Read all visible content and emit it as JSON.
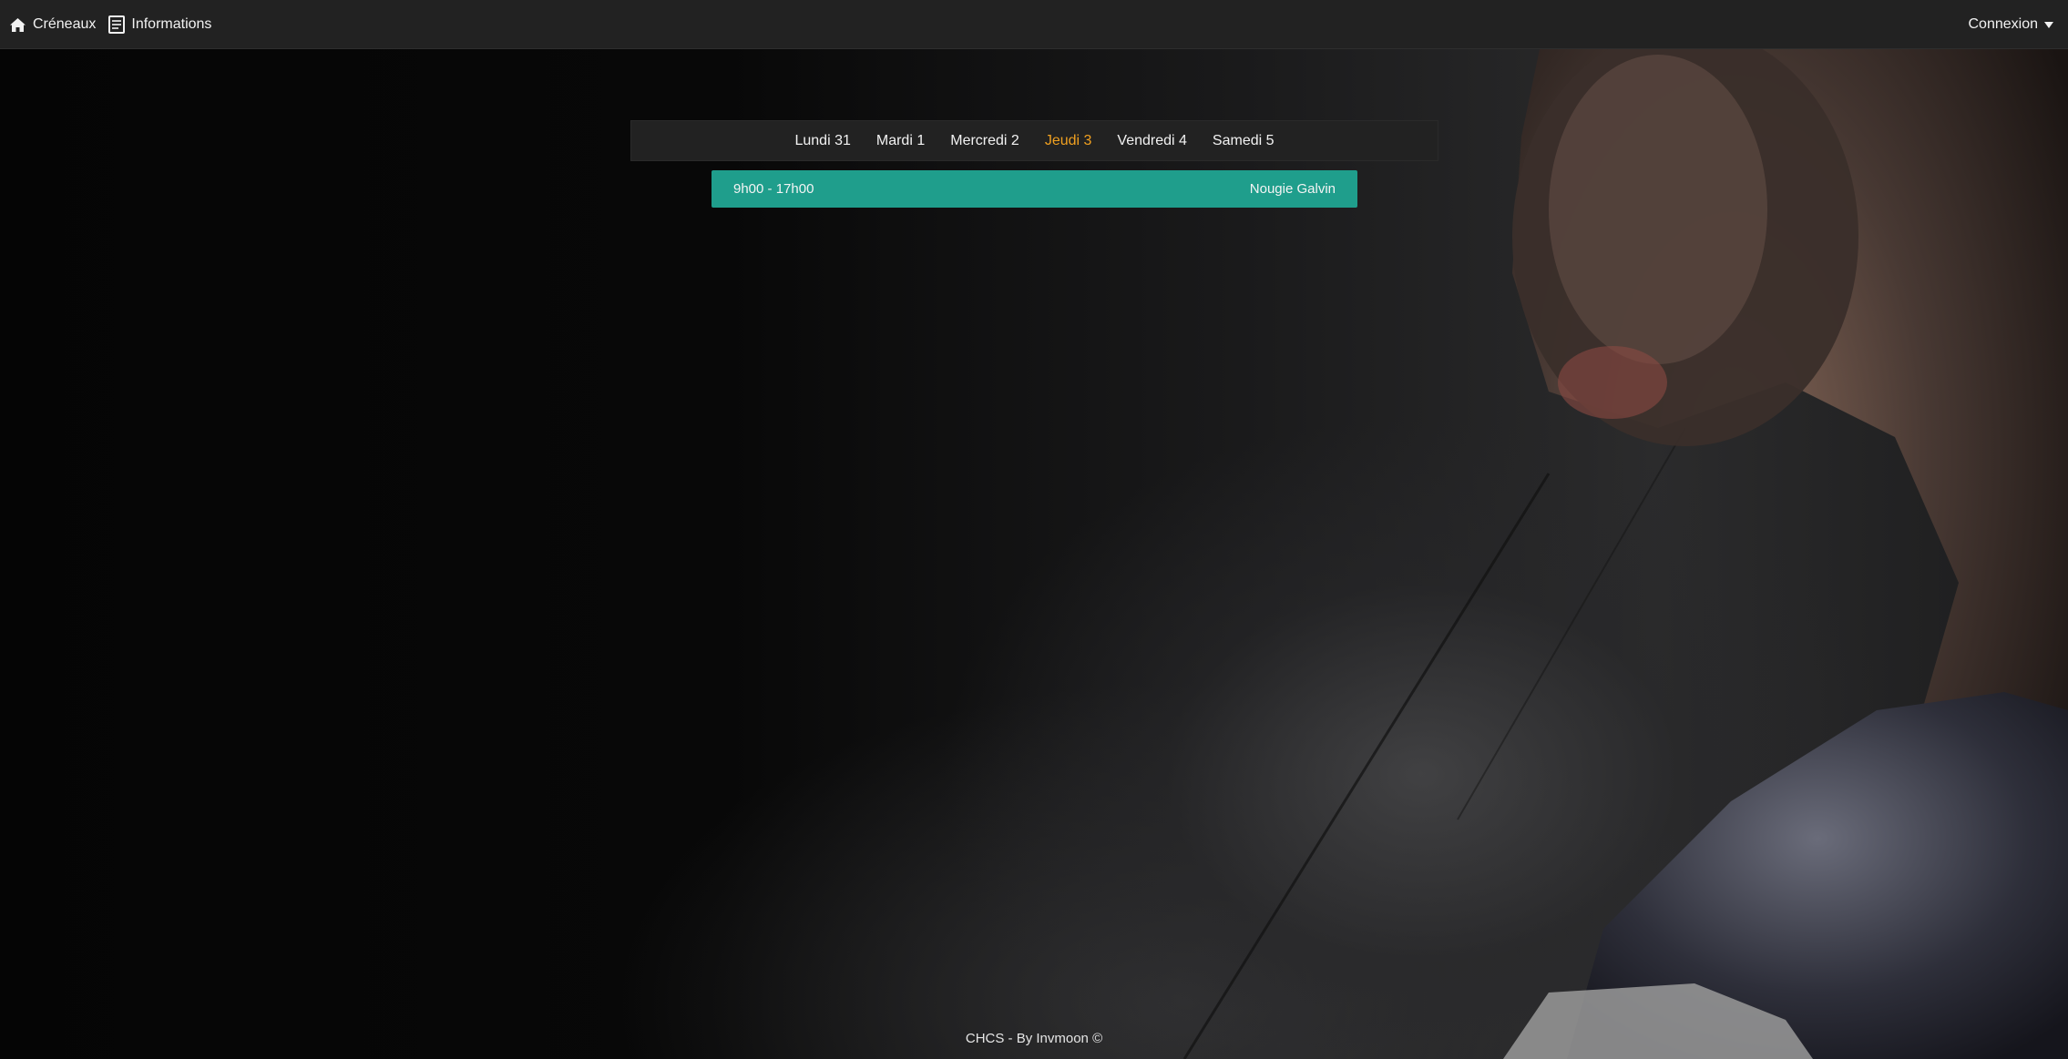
{
  "navbar": {
    "items": [
      {
        "label": "Créneaux",
        "icon": "home-icon"
      },
      {
        "label": "Informations",
        "icon": "document-icon"
      }
    ],
    "login": {
      "label": "Connexion",
      "icon": "caret-down-icon"
    }
  },
  "days": [
    {
      "label": "Lundi 31",
      "active": false
    },
    {
      "label": "Mardi 1",
      "active": false
    },
    {
      "label": "Mercredi 2",
      "active": false
    },
    {
      "label": "Jeudi 3",
      "active": true
    },
    {
      "label": "Vendredi 4",
      "active": false
    },
    {
      "label": "Samedi 5",
      "active": false
    }
  ],
  "slots": [
    {
      "time": "9h00 - 17h00",
      "name": "Nougie Galvin"
    }
  ],
  "footer": {
    "text": "CHCS - By Invmoon ©"
  },
  "colors": {
    "navbar": "#222222",
    "active_day": "#f0a020",
    "slot": "#1f9e8c"
  }
}
